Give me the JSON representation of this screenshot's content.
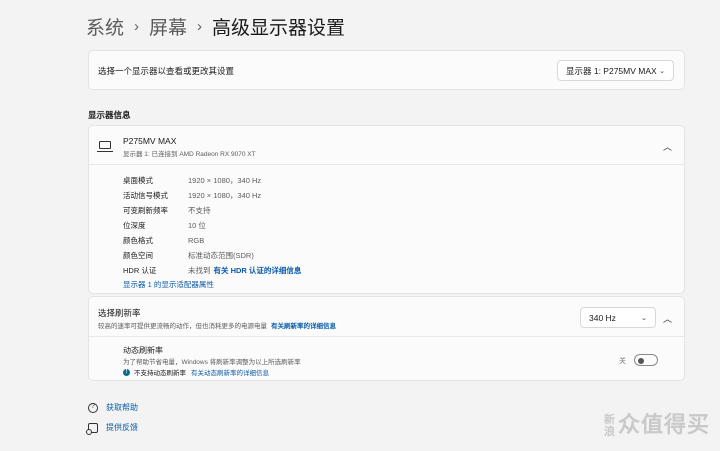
{
  "breadcrumb": {
    "items": [
      "系统",
      "屏幕"
    ],
    "current": "高级显示器设置",
    "separator": "›"
  },
  "display_select": {
    "label": "选择一个显示器以查看或更改其设置",
    "value": "显示器 1: P275MV MAX"
  },
  "section_title": "显示器信息",
  "display_info": {
    "name": "P275MV MAX",
    "subtitle": "显示器 1: 已连接到 AMD Radeon RX 9070 XT",
    "rows": [
      {
        "key": "桌面模式",
        "value": "1920 × 1080，340 Hz"
      },
      {
        "key": "活动信号模式",
        "value": "1920 × 1080，340 Hz"
      },
      {
        "key": "可变刷新频率",
        "value": "不支持"
      },
      {
        "key": "位深度",
        "value": "10 位"
      },
      {
        "key": "颜色格式",
        "value": "RGB"
      },
      {
        "key": "颜色空间",
        "value": "标准动态范围(SDR)"
      },
      {
        "key": "HDR 认证",
        "value": "未找到",
        "link": "有关 HDR 认证的详细信息"
      }
    ],
    "adapter_link": "显示器 1 的显示适配器属性"
  },
  "refresh": {
    "title": "选择刷新率",
    "desc": "较高的速率可提供更流畅的动作，但也消耗更多的电源电量",
    "desc_link": "有关刷新率的详细信息",
    "value": "340 Hz"
  },
  "dynamic_refresh": {
    "title": "动态刷新率",
    "desc": "为了帮助节省电量，Windows 将刷新率调整为以上所选刷新率",
    "warn": "不支持动态刷新率",
    "warn_link": "有关动态刷新率的详细信息",
    "toggle_label": "关",
    "toggle_on": false
  },
  "footer": {
    "help": "获取帮助",
    "feedback": "提供反馈"
  },
  "watermark": {
    "main": "众",
    "tail": "值得买",
    "small": "新浪"
  }
}
